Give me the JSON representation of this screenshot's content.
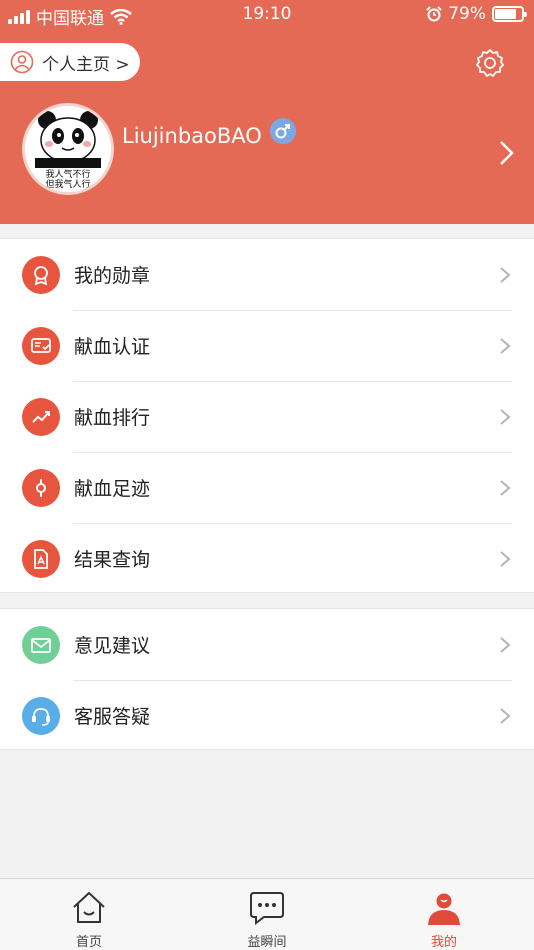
{
  "status_bar": {
    "carrier": "中国联通",
    "time": "19:10",
    "battery_percent": "79%",
    "battery_level": 0.79,
    "icons": [
      "signal-icon",
      "wifi-icon",
      "alarm-icon",
      "battery-icon"
    ]
  },
  "header": {
    "homepage_label": "个人主页 >",
    "username": "LiujinbaoBAO",
    "gender_symbol": "♂",
    "avatar_caption": "我人气不行 但我气人行",
    "background_color": "#e56a55"
  },
  "menu_group_1": [
    {
      "label": "我的勋章",
      "icon": "medal-icon",
      "color": "#e8553e"
    },
    {
      "label": "献血认证",
      "icon": "certificate-icon",
      "color": "#e8553e"
    },
    {
      "label": "献血排行",
      "icon": "trend-chart-icon",
      "color": "#e8553e"
    },
    {
      "label": "献血足迹",
      "icon": "location-pin-icon",
      "color": "#e8553e"
    },
    {
      "label": "结果查询",
      "icon": "document-icon",
      "color": "#e8553e"
    }
  ],
  "menu_group_2": [
    {
      "label": "意见建议",
      "icon": "mail-icon",
      "color": "#6fcf97"
    },
    {
      "label": "客服答疑",
      "icon": "headset-icon",
      "color": "#5aaee8"
    }
  ],
  "tabbar": [
    {
      "label": "首页",
      "icon": "home-icon",
      "active": false
    },
    {
      "label": "益瞬间",
      "icon": "chat-bubble-icon",
      "active": false
    },
    {
      "label": "我的",
      "icon": "profile-icon",
      "active": true
    }
  ],
  "colors": {
    "accent": "#e04b3a",
    "active_tab": "#e04b3a"
  }
}
